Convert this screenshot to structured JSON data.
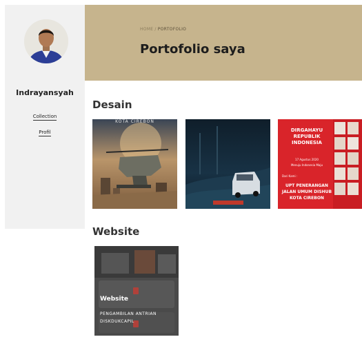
{
  "sidebar": {
    "name": "Indrayansyah",
    "links": [
      {
        "label": "Collection"
      },
      {
        "label": "Profil"
      }
    ]
  },
  "header": {
    "breadcrumb": {
      "home": "HOME",
      "current": "PORTOFOLIO"
    },
    "title": "Portofolio saya",
    "background": "#c6b48d"
  },
  "sections": {
    "desain": {
      "title": "Desain",
      "cards": [
        {
          "image_caption": "KOTA CIREBON"
        },
        {
          "image_caption": ""
        },
        {
          "poster_title": "DIRGAHAYU REPUBLIK INDONESIA",
          "poster_date": "17 Agustus 2020",
          "poster_tagline": "Menuju Indonesia Maju",
          "poster_from": "Dari Kami :",
          "poster_org": "UPT PENERANGAN JALAN UMUM DISHUB KOTA CIREBON",
          "accent": "#d9242a"
        }
      ]
    },
    "website": {
      "title": "Website",
      "cards": [
        {
          "title": "Website",
          "description": "PENGAMBILAN ANTRIAN DISKDUKCAPIL"
        }
      ]
    }
  }
}
